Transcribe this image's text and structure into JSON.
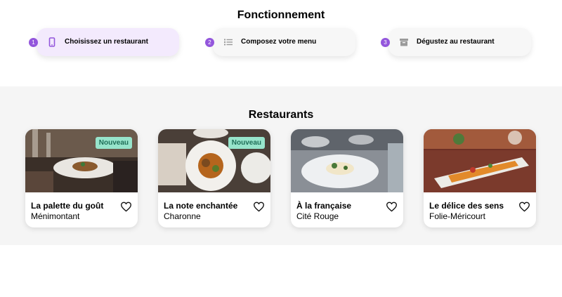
{
  "how_it_works": {
    "title": "Fonctionnement",
    "steps": [
      {
        "number": "1",
        "label": "Choisissez un restaurant",
        "icon": "smartphone-icon"
      },
      {
        "number": "2",
        "label": "Composez votre menu",
        "icon": "list-icon"
      },
      {
        "number": "3",
        "label": "Dégustez au restaurant",
        "icon": "archive-icon"
      }
    ]
  },
  "restaurants": {
    "title": "Restaurants",
    "items": [
      {
        "name": "La palette du goût",
        "area": "Ménimontant",
        "badge": "Nouveau"
      },
      {
        "name": "La note enchantée",
        "area": "Charonne",
        "badge": "Nouveau"
      },
      {
        "name": "À la française",
        "area": "Cité Rouge",
        "badge": ""
      },
      {
        "name": "Le délice des sens",
        "area": "Folie-Méricourt",
        "badge": ""
      }
    ]
  },
  "colors": {
    "accent": "#9356dc",
    "badge_bg": "#97e4cb",
    "active_step_bg": "#f3eafd",
    "section_bg": "#f5f5f5"
  }
}
